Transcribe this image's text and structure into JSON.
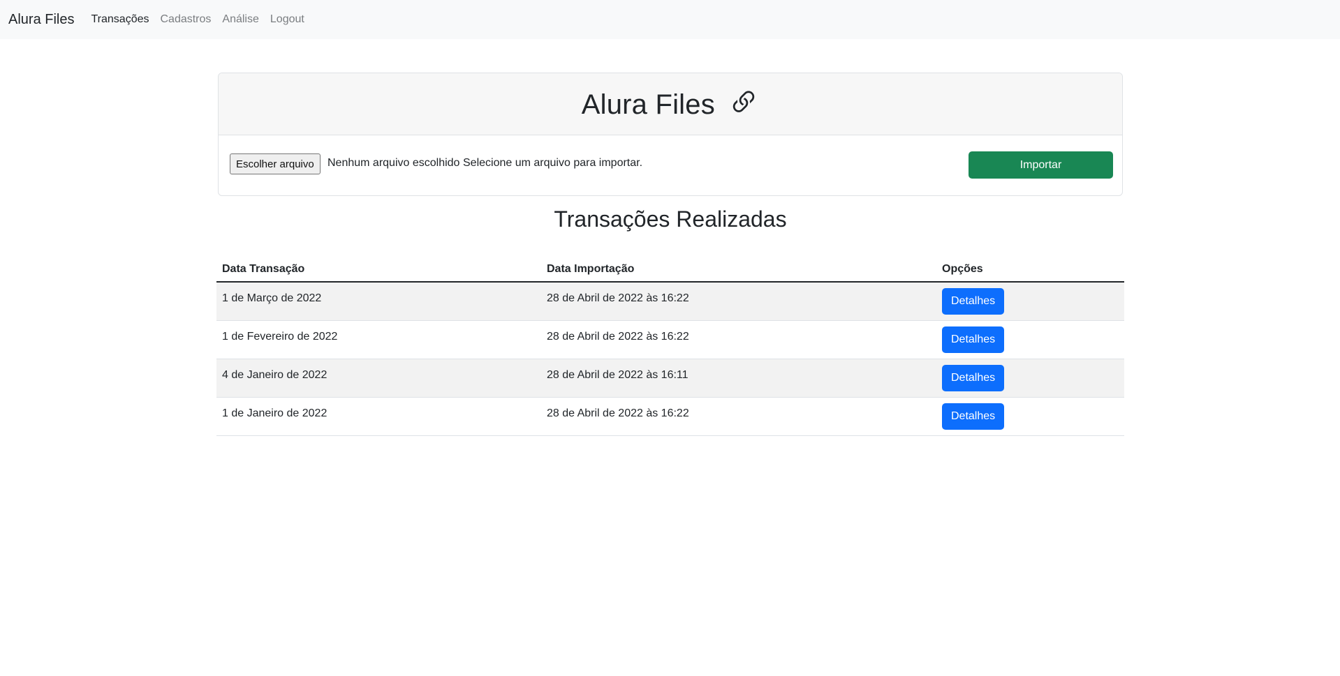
{
  "nav": {
    "brand": "Alura Files",
    "links": [
      "Transações",
      "Cadastros",
      "Análise",
      "Logout"
    ]
  },
  "card": {
    "title": "Alura Files",
    "icon": "link-icon",
    "file_button": "Escolher arquivo",
    "file_status": "Nenhum arquivo escolhido",
    "file_hint": "Selecione um arquivo para importar.",
    "import_button": "Importar"
  },
  "section_title": "Transações Realizadas",
  "table": {
    "headers": [
      "Data Transação",
      "Data Importação",
      "Opções"
    ],
    "rows": [
      {
        "data_transacao": "1 de Março de 2022",
        "data_importacao": "28 de Abril de 2022 às 16:22",
        "acao": "Detalhes"
      },
      {
        "data_transacao": "1 de Fevereiro de 2022",
        "data_importacao": "28 de Abril de 2022 às 16:22",
        "acao": "Detalhes"
      },
      {
        "data_transacao": "4 de Janeiro de 2022",
        "data_importacao": "28 de Abril de 2022 às 16:11",
        "acao": "Detalhes"
      },
      {
        "data_transacao": "1 de Janeiro de 2022",
        "data_importacao": "28 de Abril de 2022 às 16:22",
        "acao": "Detalhes"
      }
    ]
  },
  "colors": {
    "navbar_bg": "#f8f9fa",
    "import_button": "#198754",
    "detail_button": "#0d6efd",
    "text": "#212529",
    "nav_muted": "#7a7d80"
  }
}
